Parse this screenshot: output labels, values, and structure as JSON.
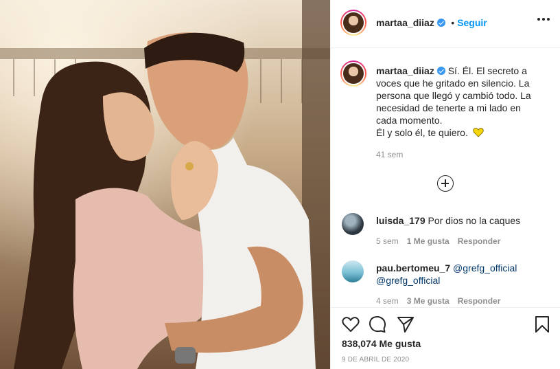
{
  "post": {
    "username": "martaa_diiaz",
    "follow_label": "Seguir",
    "separator": "•",
    "caption": "Sí. Él. El secreto a voces que he gritado en silencio. La persona que llegó y cambió todo. La necesidad de tenerte a mi lado en cada momento.\nÉl y solo él, te quiero.",
    "caption_emoji": "yellow-heart",
    "age": "41 sem",
    "likes": "838,074 Me gusta",
    "date": "9 DE ABRIL DE 2020"
  },
  "comments": [
    {
      "username": "luisda_179",
      "text": "Por dios no la caques",
      "mention": "",
      "age": "5 sem",
      "likes": "1 Me gusta",
      "reply_label": "Responder"
    },
    {
      "username": "pau.bertomeu_7",
      "text": "",
      "mention": "@grefg_official @grefg_official",
      "age": "4 sem",
      "likes": "3 Me gusta",
      "reply_label": "Responder"
    }
  ],
  "colors": {
    "accent": "#0095f6",
    "verified": "#3897f0",
    "text": "#262626",
    "muted": "#8e8e8e",
    "mention": "#00376b",
    "heart_emoji": "#f4d40b"
  },
  "icons": {
    "more": "more-dots-icon",
    "verified": "verified-badge-icon",
    "load_more": "plus-circle-icon",
    "like": "heart-outline-icon",
    "comment": "comment-bubble-icon",
    "share": "paper-plane-icon",
    "save": "bookmark-icon"
  }
}
